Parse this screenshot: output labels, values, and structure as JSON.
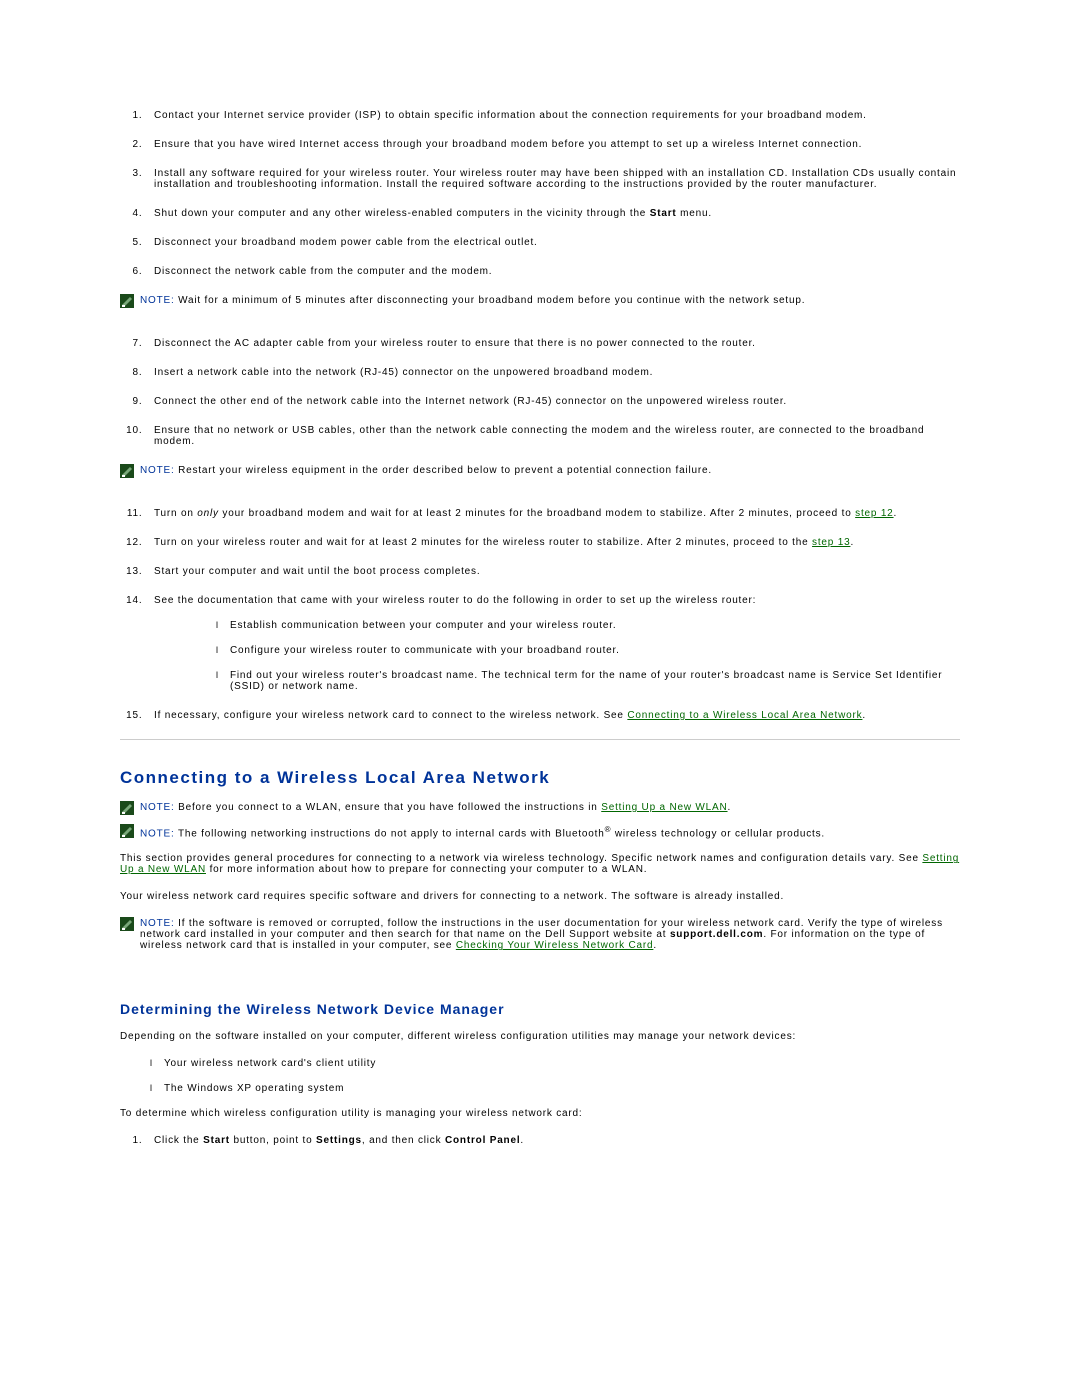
{
  "steps": {
    "s1": "Contact your Internet service provider (ISP) to obtain specific information about the connection requirements for your broadband modem.",
    "s2": "Ensure that you have wired Internet access through your broadband modem before you attempt to set up a wireless Internet connection.",
    "s3": "Install any software required for your wireless router. Your wireless router may have been shipped with an installation CD. Installation CDs usually contain installation and troubleshooting information. Install the required software according to the instructions provided by the router manufacturer.",
    "s4_pre": "Shut down your computer and any other wireless-enabled computers in the vicinity through the ",
    "s4_bold": "Start",
    "s4_post": " menu.",
    "s5": "Disconnect your broadband modem power cable from the electrical outlet.",
    "s6": "Disconnect the network cable from the computer and the modem.",
    "s7": "Disconnect the AC adapter cable from your wireless router to ensure that there is no power connected to the router.",
    "s8": "Insert a network cable into the network (RJ-45) connector on the unpowered broadband modem.",
    "s9": "Connect the other end of the network cable into the Internet network (RJ-45) connector on the unpowered wireless router.",
    "s10": "Ensure that no network or USB cables, other than the network cable connecting the modem and the wireless router, are connected to the broadband modem.",
    "s11_pre": "Turn on ",
    "s11_em": "only",
    "s11_mid": " your broadband modem and wait for at least 2 minutes for the broadband modem to stabilize. After 2 minutes, proceed to ",
    "s11_link": "step 12",
    "s11_post": ".",
    "s12_pre": "Turn on your wireless router and wait for at least 2 minutes for the wireless router to stabilize. After 2 minutes, proceed to the ",
    "s12_link": "step 13",
    "s12_post": ".",
    "s13": "Start your computer and wait until the boot process completes.",
    "s14": "See the documentation that came with your wireless router to do the following in order to set up the wireless router:",
    "s14a": "Establish communication between your computer and your wireless router.",
    "s14b": "Configure your wireless router to communicate with your broadband router.",
    "s14c": "Find out your wireless router's broadcast name. The technical term for the name of your router's broadcast name is Service Set Identifier (SSID) or network name.",
    "s15_pre": "If necessary, configure your wireless network card to connect to the wireless network. See ",
    "s15_link": "Connecting to a Wireless Local Area Network",
    "s15_post": "."
  },
  "notes": {
    "label": "NOTE: ",
    "n1": "Wait for a minimum of 5 minutes after disconnecting your broadband modem before you continue with the network setup.",
    "n2": "Restart your wireless equipment in the order described below to prevent a potential connection failure.",
    "n3_pre": "Before you connect to a WLAN, ensure that you have followed the instructions in ",
    "n3_link": "Setting Up a New WLAN",
    "n3_post": ".",
    "n4_pre": "The following networking instructions do not apply to internal cards with Bluetooth",
    "n4_post": " wireless technology or cellular products.",
    "n5_pre": "If the software is removed or corrupted, follow the instructions in the user documentation for your wireless network card. Verify the type of wireless network card installed in your computer and then search for that name on the Dell Support website at ",
    "n5_bold": "support.dell.com",
    "n5_mid": ". For information on the type of wireless network card that is installed in your computer, see ",
    "n5_link": "Checking Your Wireless Network Card",
    "n5_post": "."
  },
  "section2": {
    "title": "Connecting to a Wireless Local Area Network",
    "p1_pre": "This section provides general procedures for connecting to a network via wireless technology. Specific network names and configuration details vary. See ",
    "p1_link": "Setting Up a New WLAN",
    "p1_post": " for more information about how to prepare for connecting your computer to a WLAN.",
    "p2": "Your wireless network card requires specific software and drivers for connecting to a network. The software is already installed."
  },
  "section3": {
    "title": "Determining the Wireless Network Device Manager",
    "p1": "Depending on the software installed on your computer, different wireless configuration utilities may manage your network devices:",
    "li1": "Your wireless network card's client utility",
    "li2": "The Windows XP operating system",
    "p2": "To determine which wireless configuration utility is managing your wireless network card:",
    "step1_pre": "Click the ",
    "step1_b1": "Start",
    "step1_mid1": " button, point to ",
    "step1_b2": "Settings",
    "step1_mid2": ", and then click ",
    "step1_b3": "Control Panel",
    "step1_post": "."
  }
}
